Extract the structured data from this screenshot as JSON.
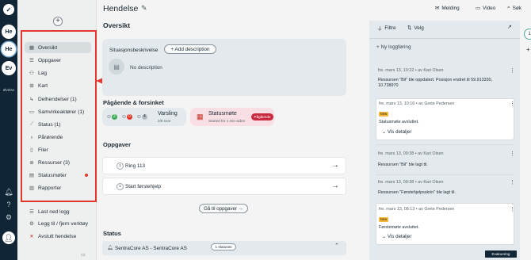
{
  "rail": {
    "avatars": [
      "He",
      "He",
      "Ev"
    ],
    "label": "Øvelse"
  },
  "sidenav": {
    "plus": "+",
    "items": [
      {
        "label": "Oversikt",
        "icon": "grid-icon",
        "glyph": "▦"
      },
      {
        "label": "Oppgaver",
        "icon": "checklist-icon",
        "glyph": "☰"
      },
      {
        "label": "Lag",
        "icon": "team-icon",
        "glyph": "⚇"
      },
      {
        "label": "Kart",
        "icon": "map-icon",
        "glyph": "⊞"
      },
      {
        "label": "Delhendelser (1)",
        "icon": "sub-event-icon",
        "glyph": "↳"
      },
      {
        "label": "Samvirkeaktører (1)",
        "icon": "partners-icon",
        "glyph": "▭"
      },
      {
        "label": "Status (1)",
        "icon": "status-icon",
        "glyph": "⟋"
      },
      {
        "label": "Pårørende",
        "icon": "relatives-icon",
        "glyph": "♁"
      },
      {
        "label": "Filer",
        "icon": "file-icon",
        "glyph": "▯"
      },
      {
        "label": "Ressurser (3)",
        "icon": "resources-icon",
        "glyph": "⊕"
      },
      {
        "label": "Statusmøter",
        "icon": "meeting-icon",
        "glyph": "▤"
      },
      {
        "label": "Rapporter",
        "icon": "report-icon",
        "glyph": "▥"
      }
    ],
    "extra": [
      {
        "label": "Last ned logg",
        "icon": "download-icon",
        "glyph": "☰"
      },
      {
        "label": "Legg til / fjern verktøy",
        "icon": "tools-icon",
        "glyph": "⚙"
      },
      {
        "label": "Avslutt hendelse",
        "icon": "close-icon",
        "glyph": "✕"
      }
    ]
  },
  "header": {
    "title": "Hendelse",
    "melding": "Melding",
    "video": "Video",
    "sok": "Søk"
  },
  "overview": {
    "heading": "Oversikt",
    "situation_label": "Situasjonsbeskrivelse",
    "add_description": "+ Add description",
    "no_description": "No description"
  },
  "ongoing": {
    "heading": "Pågående & forsinket",
    "counts": [
      "2",
      "0",
      "4"
    ],
    "alert_title": "Varsling",
    "alert_sub": "2/8 svar",
    "meeting_title": "Statusmøte",
    "meeting_sub": "Started for 1 min siden",
    "meeting_badge": "Pågående"
  },
  "tasks": {
    "heading": "Oppgaver",
    "items": [
      {
        "num": "1",
        "label": "Ring 113"
      },
      {
        "num": "1",
        "label": "Start førstehjelp"
      }
    ],
    "goto": "Gå til oppgaver →"
  },
  "status": {
    "heading": "Status",
    "label": "SentraCore AS - SentraCore AS",
    "badge": "1 statuses"
  },
  "log": {
    "filter": "Filtre",
    "select": "Velg",
    "new_entry": "+ Ny loggføring",
    "entries": [
      {
        "meta": "fre. mars 13, 10:22 • av Kari Olsen",
        "text": "Ressursen \"Bil\" ble oppdatert. Posisjon endret til 59.913330, 10.738970"
      },
      {
        "meta": "fre. mars 13, 10:16 • av Grete Pedersen",
        "badge": "New",
        "text": "Statusmøte avsluttet.",
        "details": "Vis detaljer"
      },
      {
        "meta": "fre. mars 13, 09:38 • av Kari Olsen",
        "text": "Ressursen \"Bil\" ble lagt til."
      },
      {
        "meta": "fre. mars 13, 09:38 • av Kari Olsen",
        "text": "Ressursen \"Førstehjelpsskrin\" ble lagt til."
      },
      {
        "meta": "fre. mars 13, 08:13 • av Grete Pedersen",
        "badge": "New",
        "text": "Førstemøte avsluttet.",
        "details": "Vis detaljer"
      }
    ],
    "evac": "Evakuering"
  },
  "colors": {
    "rail": "#102636",
    "highlight": "#e3382b",
    "panel": "#e3e9ec",
    "badge_ongoing": "#c82a3e"
  }
}
